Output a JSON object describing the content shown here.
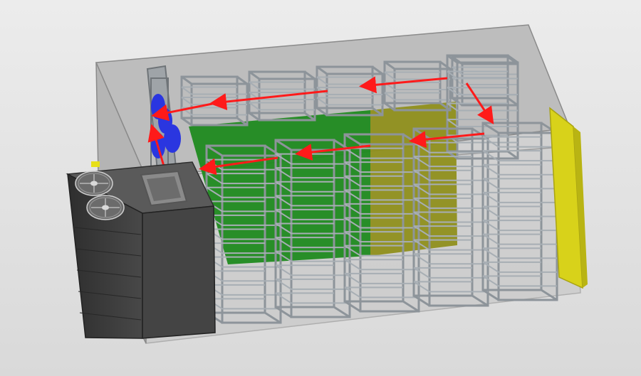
{
  "scene": {
    "subject": "drying-chamber-airflow-cad",
    "colors": {
      "background_top": "#ececec",
      "background_bottom": "#d8d8d8",
      "chamber_fill": "#b9b9b9",
      "chamber_edge": "#8a8a8a",
      "rack_frame": "#8d949a",
      "rack_shelf": "#a7aeb4",
      "partition_green": "#1f8a1f",
      "partition_olive": "#8f8f1c",
      "door_yellow": "#d8d21a",
      "heat_pump_body": "#3a3a3a",
      "fan_blue": "#2a36e0",
      "airflow_arrow": "#ff1a1a"
    },
    "icons": [
      "airflow-arrow",
      "condenser-fan",
      "circulation-fan"
    ],
    "rack_counts": {
      "back_row": 5,
      "front_row": 5
    }
  }
}
